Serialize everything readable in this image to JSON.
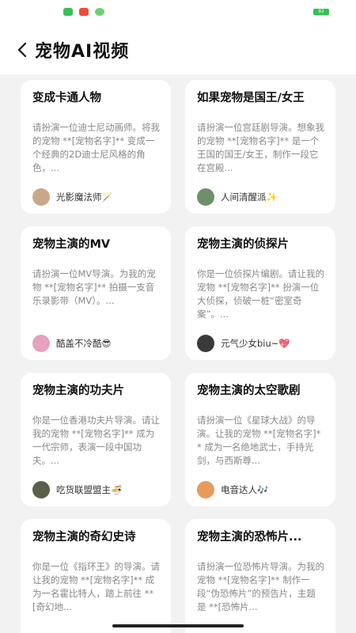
{
  "status_bar": {
    "icons": [
      {
        "name": "message-app-icon",
        "color": "#3bbf59"
      },
      {
        "name": "video-app-icon",
        "color": "#ef4b3a"
      },
      {
        "name": "wechat-app-icon",
        "color": "#6fcf76"
      }
    ],
    "battery": "92",
    "battery_color": "#2cc34a"
  },
  "header": {
    "title": "宠物AI视频",
    "back_icon": "chevron-left-icon"
  },
  "cards": [
    {
      "title": "变成卡通人物",
      "desc": "请扮演一位迪士尼动画师。将我的宠物 **[宠物名字]** 变成一个经典的2D迪士尼风格的角色，...",
      "author": "光影魔法师🪄",
      "avatar_color": "#c9a88a"
    },
    {
      "title": "如果宠物是国王/女王",
      "desc": "请扮演一位宫廷剧导演。想象我的宠物 **[宠物名字]** 是一个王国的国王/女王，制作一段它在宫殿...",
      "author": "人间清醒派✨",
      "avatar_color": "#6f8f6a"
    },
    {
      "title": "宠物主演的MV",
      "desc": "请扮演一位MV导演。为我的宠物 **[宠物名字]** 拍摄一支音乐录影带（MV）。...",
      "author": "酷盖不冷酷😎",
      "avatar_color": "#e6a2c0"
    },
    {
      "title": "宠物主演的侦探片",
      "desc": "你是一位侦探片编剧。请让我的宠物 **[宠物名字]** 扮演一位大侦探，侦破一桩“密室奇案”。...",
      "author": "元气少女biu~💖",
      "avatar_color": "#3a3a3a"
    },
    {
      "title": "宠物主演的功夫片",
      "desc": "你是一位香港功夫片导演。请让我的宠物 **[宠物名字]** 成为一代宗师，表演一段中国功夫。...",
      "author": "吃货联盟盟主🍜",
      "avatar_color": "#5a5f4a"
    },
    {
      "title": "宠物主演的太空歌剧",
      "desc": "请扮演一位《星球大战》的导演。让我的宠物 **[宠物名字]** 成为一名绝地武士，手持光剑，与西斯尊...",
      "author": "电音达人🎶",
      "avatar_color": "#e89a5c"
    },
    {
      "title": "宠物主演的奇幻史诗",
      "desc": "你是一位《指环王》的导演。请让我的宠物 **[宠物名字]** 成为一名霍比特人，踏上前往 **[奇幻地...",
      "author": "",
      "avatar_color": ""
    },
    {
      "title": "宠物主演的恐怖片...",
      "desc": "请扮演一位恐怖片导演。为我的宠物 **[宠物名字]** 制作一段“伪恐怖片”的预告片，主题是 **[恐怖片...",
      "author": "",
      "avatar_color": ""
    }
  ]
}
